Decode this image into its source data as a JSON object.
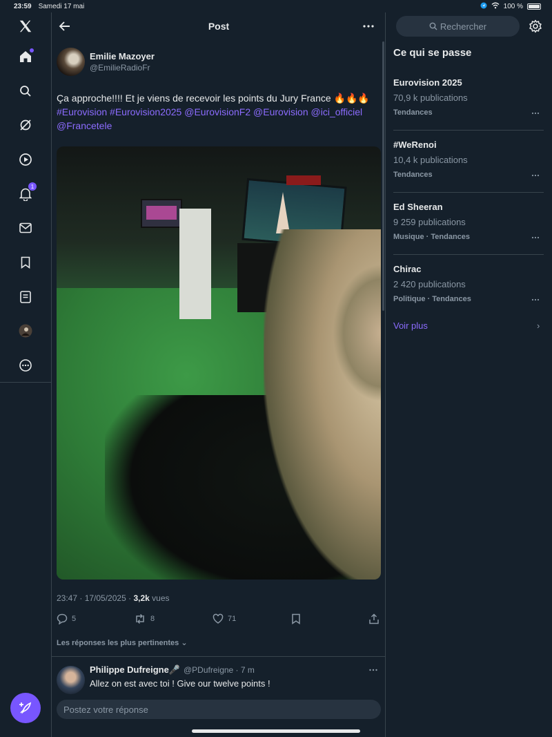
{
  "status_bar": {
    "time": "23:59",
    "date": "Samedi 17 mai",
    "battery": "100 %"
  },
  "header": {
    "title": "Post"
  },
  "post": {
    "author_name": "Emilie Mazoyer",
    "author_handle": "@EmilieRadioFr",
    "text_plain": "Ça approche!!!! Et je viens de recevoir les points du Jury France 🔥🔥🔥",
    "links": [
      "#Eurovision",
      "#Eurovision2025",
      "@EurovisionF2",
      "@Eurovision",
      "@ici_officiel",
      "@Francetele"
    ],
    "timestamp": "23:47 · 17/05/2025 ·",
    "views_count": "3,2k",
    "views_label": "vues",
    "replies": "5",
    "reposts": "8",
    "likes": "71"
  },
  "replies_sort": "Les réponses les plus pertinentes",
  "reply": {
    "name": "Philippe Dufreigne🎤",
    "handle": "@PDufreigne · 7 m",
    "text": "Allez on est avec toi ! Give our twelve points !"
  },
  "reply_box": {
    "placeholder": "Postez votre réponse"
  },
  "sidebar": {
    "search_placeholder": "Rechercher",
    "title": "Ce qui se passe",
    "trends": [
      {
        "title": "Eurovision 2025",
        "count": "70,9 k publications",
        "category": "Tendances"
      },
      {
        "title": "#WeRenoi",
        "count": "10,4 k publications",
        "category": "Tendances"
      },
      {
        "title": "Ed Sheeran",
        "count": "9 259 publications",
        "category": "Musique · Tendances"
      },
      {
        "title": "Chirac",
        "count": "2 420 publications",
        "category": "Politique · Tendances"
      }
    ],
    "see_more": "Voir plus"
  },
  "nav": {
    "notifications_badge": "1"
  },
  "colors": {
    "background": "#15202b",
    "accent": "#7856ff",
    "muted": "#8b98a5"
  }
}
